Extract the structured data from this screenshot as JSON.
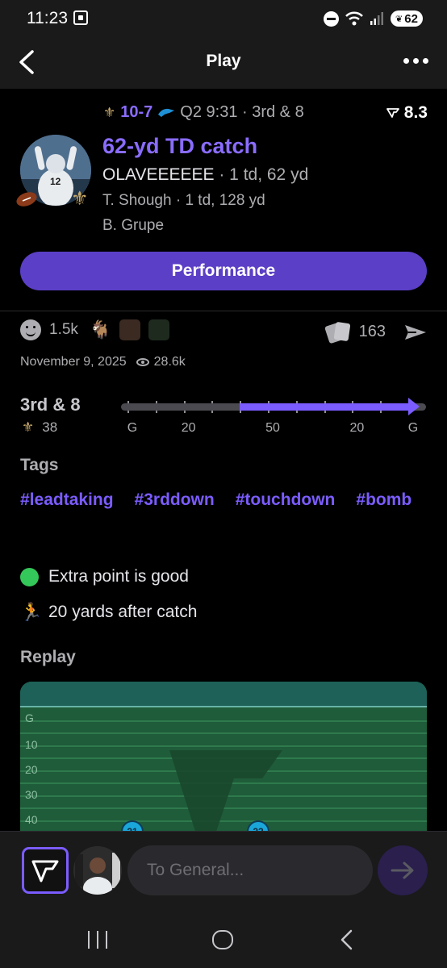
{
  "status_bar": {
    "time": "11:23",
    "battery": "62"
  },
  "nav": {
    "title": "Play"
  },
  "play": {
    "score": "10-7",
    "situation": "Q2 9:31 · 3rd & 8",
    "rating": "8.3",
    "title": "62-yd TD catch",
    "primary_player": "OLAVEEEEEE",
    "primary_stat": " · 1 td, 62 yd",
    "secondary_player": "T. Shough · 1 td, 128 yd",
    "tertiary_player": "B. Grupe",
    "performance_label": "Performance"
  },
  "engagement": {
    "reactions_count": "1.5k",
    "cards_count": "163",
    "date": "November 9, 2025",
    "views": "28.6k"
  },
  "field_position": {
    "down": "3rd & 8",
    "yard_line": "38",
    "labels": [
      "G",
      "20",
      "50",
      "20",
      "G"
    ],
    "start_fraction": 0.4,
    "end_fraction": 1.0
  },
  "tags": {
    "title": "Tags",
    "items": [
      "#leadtaking",
      "#3rddown",
      "#touchdown",
      "#bomb"
    ]
  },
  "notes": [
    {
      "icon": "green-circle-icon",
      "text": "Extra point is good"
    },
    {
      "icon": "runner-icon",
      "text": "20 yards after catch"
    }
  ],
  "replay": {
    "title": "Replay",
    "yard_labels": [
      "G",
      "10",
      "20",
      "30",
      "40"
    ],
    "players": [
      "21",
      "22"
    ]
  },
  "composer": {
    "placeholder": "To General..."
  },
  "colors": {
    "accent": "#7b5cff",
    "button": "#5b3fc6",
    "background": "#000000",
    "field": "#1f5c3a"
  }
}
